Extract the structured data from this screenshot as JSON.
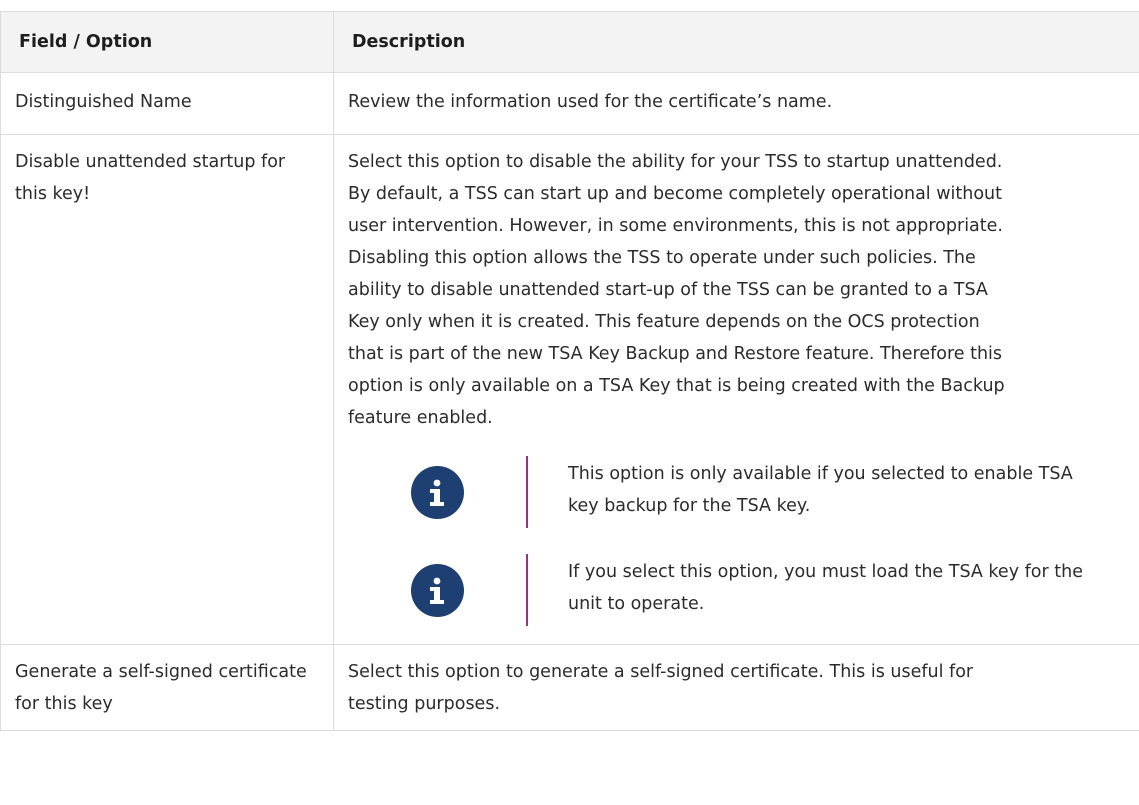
{
  "table": {
    "headers": {
      "field": "Field / Option",
      "description": "Description"
    },
    "rows": [
      {
        "field": "Distinguished Name",
        "description": [
          "Review the information used for the certificate’s name."
        ]
      },
      {
        "field": "Disable unattended startup for this key!",
        "description": [
          "Select this option to disable the ability for your TSS to startup unattended.",
          "By default, a TSS can start up and become completely operational without",
          "user intervention. However, in some environments, this is not appropriate.",
          "Disabling this option allows the TSS to operate under such policies. The",
          "ability to disable unattended start-up of the TSS can be granted to a TSA",
          "Key only when it is created. This feature depends on the OCS protection",
          "that is part of the new TSA Key Backup and Restore feature. Therefore this",
          "option is only available on a TSA Key that is being created with the Backup",
          "feature enabled."
        ],
        "notes": [
          {
            "icon": "info-icon",
            "text": "This option is only available if you selected to enable TSA key backup for the TSA key."
          },
          {
            "icon": "info-icon",
            "text": "If you select this option, you must load the TSA key for the unit to operate."
          }
        ]
      },
      {
        "field": "Generate a self-signed certificate for this key",
        "description": [
          "Select this option to generate a self-signed certificate. This is useful for",
          "testing purposes."
        ]
      }
    ]
  },
  "colors": {
    "header_bg": "#f3f3f4",
    "icon_bg": "#1e3f72",
    "note_bar": "#93357f",
    "border": "#dcdcdc"
  }
}
